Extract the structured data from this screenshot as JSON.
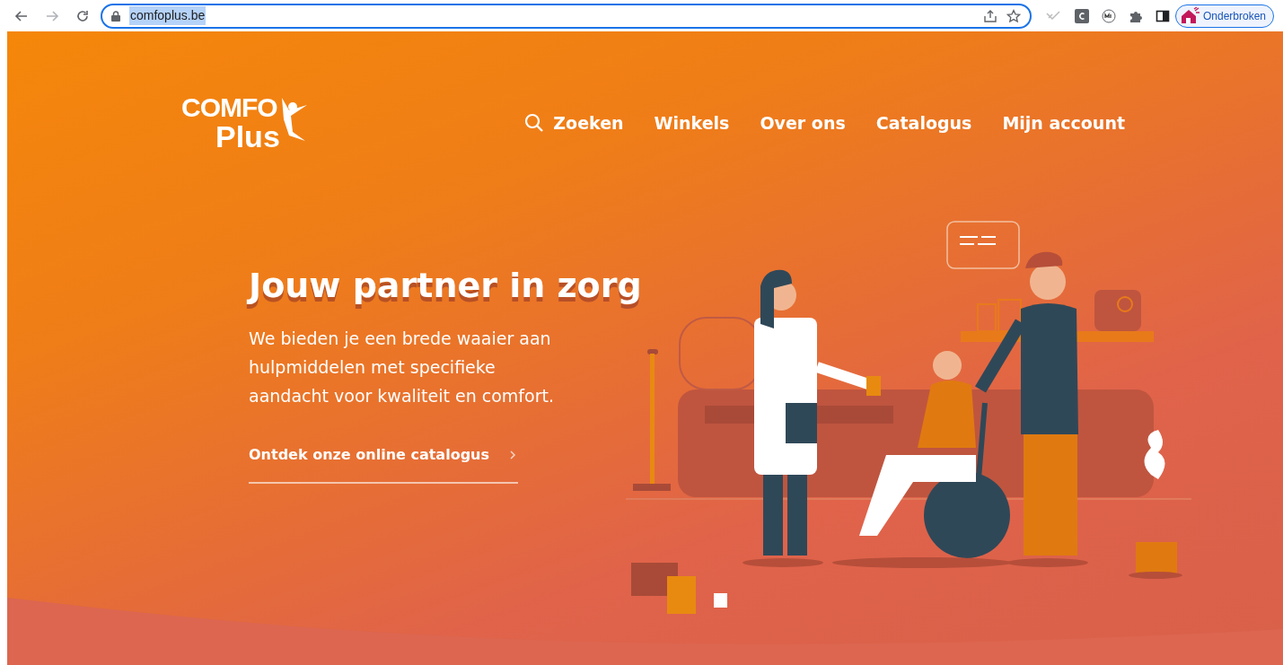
{
  "browser": {
    "url": "comfoplus.be",
    "profile_label": "Onderbroken"
  },
  "logo": {
    "line_1": "COMFO",
    "line_2": "Plus"
  },
  "nav": [
    {
      "label": "Zoeken",
      "kind": "search"
    },
    {
      "label": "Winkels",
      "kind": "link"
    },
    {
      "label": "Over ons",
      "kind": "link"
    },
    {
      "label": "Catalogus",
      "kind": "link"
    },
    {
      "label": "Mijn account",
      "kind": "link"
    }
  ],
  "hero": {
    "title": "Jouw partner in zorg",
    "text": "We bieden je een brede waaier aan hulpmiddelen met specifieke aandacht voor kwaliteit en comfort.",
    "cta": "Ontdek onze online catalogus"
  }
}
